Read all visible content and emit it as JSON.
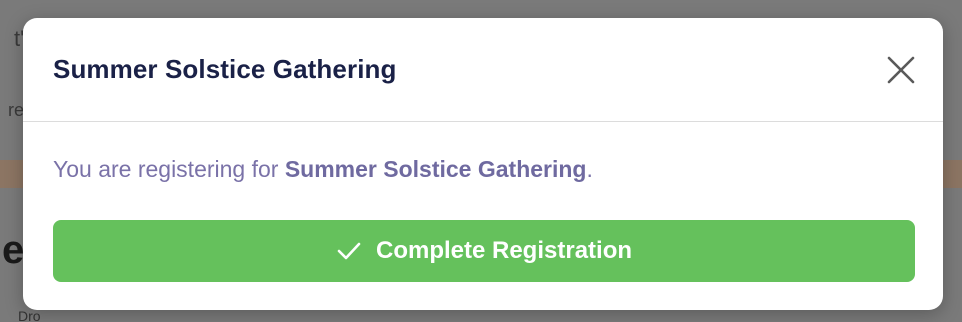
{
  "background": {
    "fragment_a": "t'",
    "fragment_b": "re",
    "fragment_c": "e",
    "fragment_d": "Dro"
  },
  "modal": {
    "title": "Summer Solstice Gathering",
    "close_icon": "close-icon",
    "message_prefix": "You are registering for ",
    "event_name": "Summer Solstice Gathering",
    "message_suffix": ".",
    "button": {
      "icon": "checkmark-icon",
      "label": "Complete Registration"
    }
  },
  "colors": {
    "title": "#1a2147",
    "message": "#7a72a8",
    "button_bg": "#65c15c",
    "button_text": "#ffffff",
    "overlay": "#7a7a7a"
  }
}
